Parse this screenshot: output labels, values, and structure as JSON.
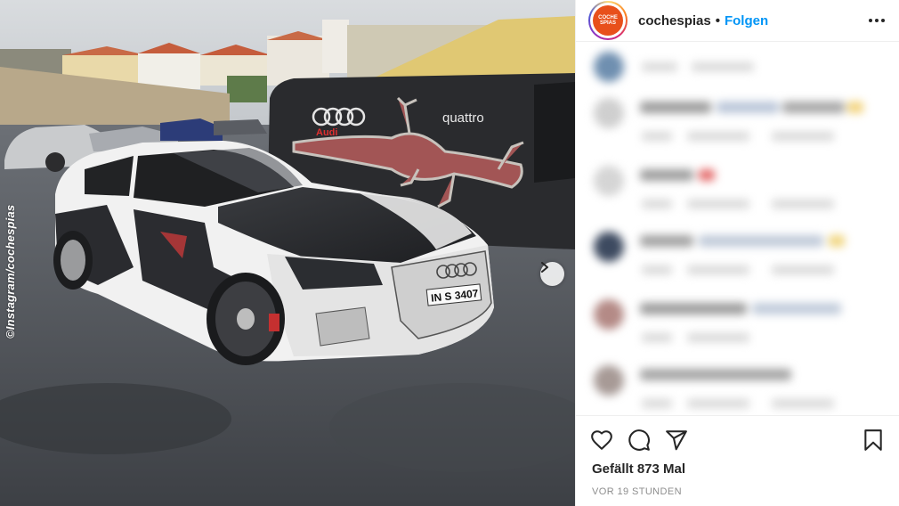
{
  "post": {
    "watermark": "©Instagram/cochespias",
    "van_brand": "quattro",
    "van_logo_text": "Audi",
    "license_plate": "IN S 3407"
  },
  "header": {
    "avatar_text_line1": "COCHE",
    "avatar_text_line2": "SPIAS",
    "username": "cochespias",
    "separator": "•",
    "follow_label": "Folgen"
  },
  "actions": {
    "like_icon": "heart-icon",
    "comment_icon": "comment-icon",
    "share_icon": "paper-plane-icon",
    "save_icon": "bookmark-icon",
    "likes_text": "Gefällt 873 Mal",
    "timestamp": "VOR 19 STUNDEN"
  },
  "colors": {
    "follow": "#0095f6",
    "avatar": "#e8501b",
    "timestamp": "#8e8e8e"
  }
}
